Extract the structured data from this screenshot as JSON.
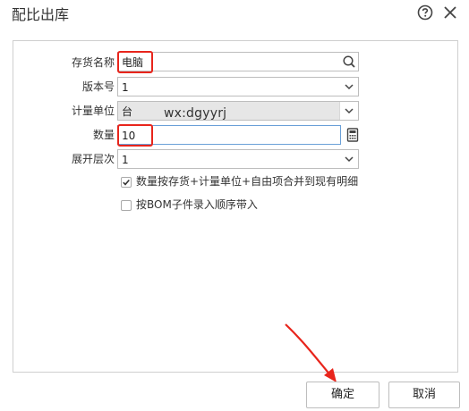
{
  "window": {
    "title": "配比出库"
  },
  "form": {
    "fields": [
      {
        "label": "存货名称",
        "value": "电脑"
      },
      {
        "label": "版本号",
        "value": "1"
      },
      {
        "label": "计量单位",
        "value": "台"
      },
      {
        "label": "数量",
        "value": "10"
      },
      {
        "label": "展开层次",
        "value": "1"
      }
    ],
    "overlay_text": "wx:dgyyrj",
    "options": [
      {
        "label": "数量按存货+计量单位+自由项合并到现有明细",
        "checked": true
      },
      {
        "label": "按BOM子件录入顺序带入",
        "checked": false
      }
    ]
  },
  "footer": {
    "ok_label": "确定",
    "cancel_label": "取消"
  },
  "colors": {
    "highlight": "#e8251c",
    "accent": "#e8251c"
  }
}
